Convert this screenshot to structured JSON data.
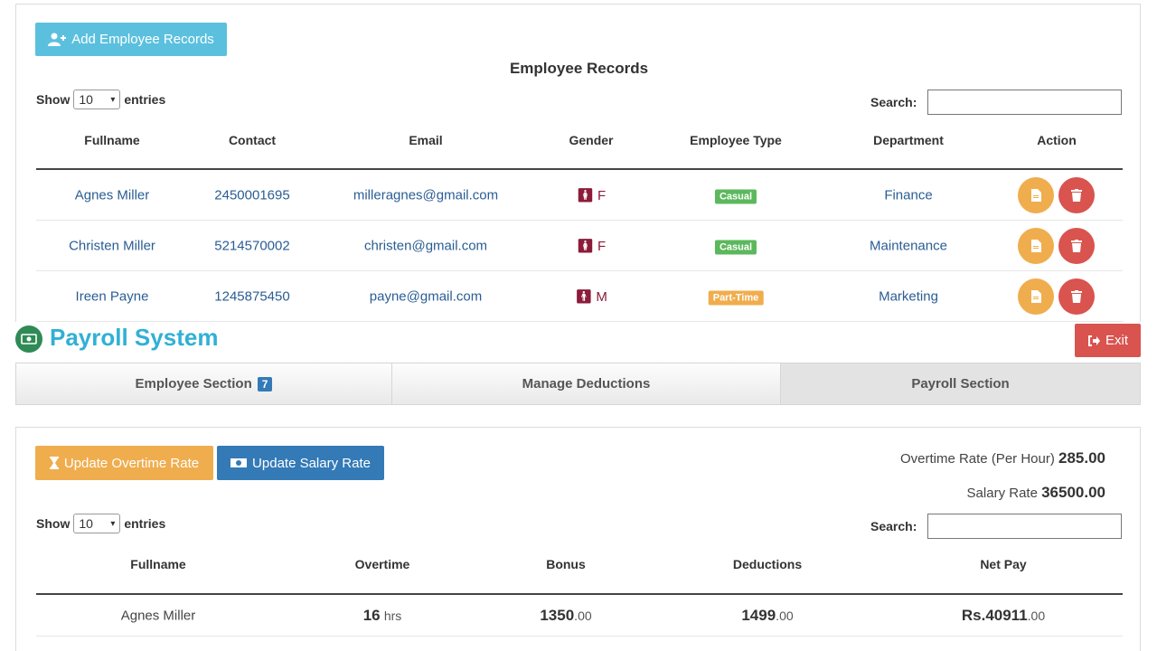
{
  "employee_records": {
    "add_button": "Add Employee Records",
    "title": "Employee Records",
    "show_label": "Show",
    "entries_value": "10",
    "entries_label": "entries",
    "search_label": "Search:",
    "columns": [
      "Fullname",
      "Contact",
      "Email",
      "Gender",
      "Employee Type",
      "Department",
      "Action"
    ],
    "rows": [
      {
        "fullname": "Agnes Miller",
        "contact": "2450001695",
        "email": "milleragnes@gmail.com",
        "gender": "F",
        "type": "Casual",
        "type_color": "#5cb85c",
        "department": "Finance"
      },
      {
        "fullname": "Christen Miller",
        "contact": "5214570002",
        "email": "christen@gmail.com",
        "gender": "F",
        "type": "Casual",
        "type_color": "#5cb85c",
        "department": "Maintenance"
      },
      {
        "fullname": "Ireen Payne",
        "contact": "1245875450",
        "email": "payne@gmail.com",
        "gender": "M",
        "type": "Part-Time",
        "type_color": "#f0ad4e",
        "department": "Marketing"
      }
    ]
  },
  "header": {
    "app_title": "Payroll System",
    "exit_button": "Exit"
  },
  "tabs": [
    {
      "label": "Employee Section",
      "badge": "7"
    },
    {
      "label": "Manage Deductions"
    },
    {
      "label": "Payroll Section"
    }
  ],
  "payroll": {
    "overtime_button": "Update Overtime Rate",
    "salary_button": "Update Salary Rate",
    "overtime_rate_label": "Overtime Rate (Per Hour)",
    "overtime_rate_value": "285.00",
    "salary_rate_label": "Salary Rate",
    "salary_rate_value": "36500.00",
    "show_label": "Show",
    "entries_value": "10",
    "entries_label": "entries",
    "search_label": "Search:",
    "columns": [
      "Fullname",
      "Overtime",
      "Bonus",
      "Deductions",
      "Net Pay"
    ],
    "rows": [
      {
        "fullname": "Agnes Miller",
        "overtime": "16",
        "overtime_unit": "hrs",
        "bonus": "1350",
        "bonus_dec": ".00",
        "deductions": "1499",
        "deductions_dec": ".00",
        "netpay": "Rs.40911",
        "netpay_dec": ".00"
      }
    ]
  },
  "colors": {
    "info": "#5bc0de",
    "warning": "#f0ad4e",
    "primary": "#337ab7",
    "danger": "#d9534f",
    "title_blue": "#31b0d5"
  }
}
